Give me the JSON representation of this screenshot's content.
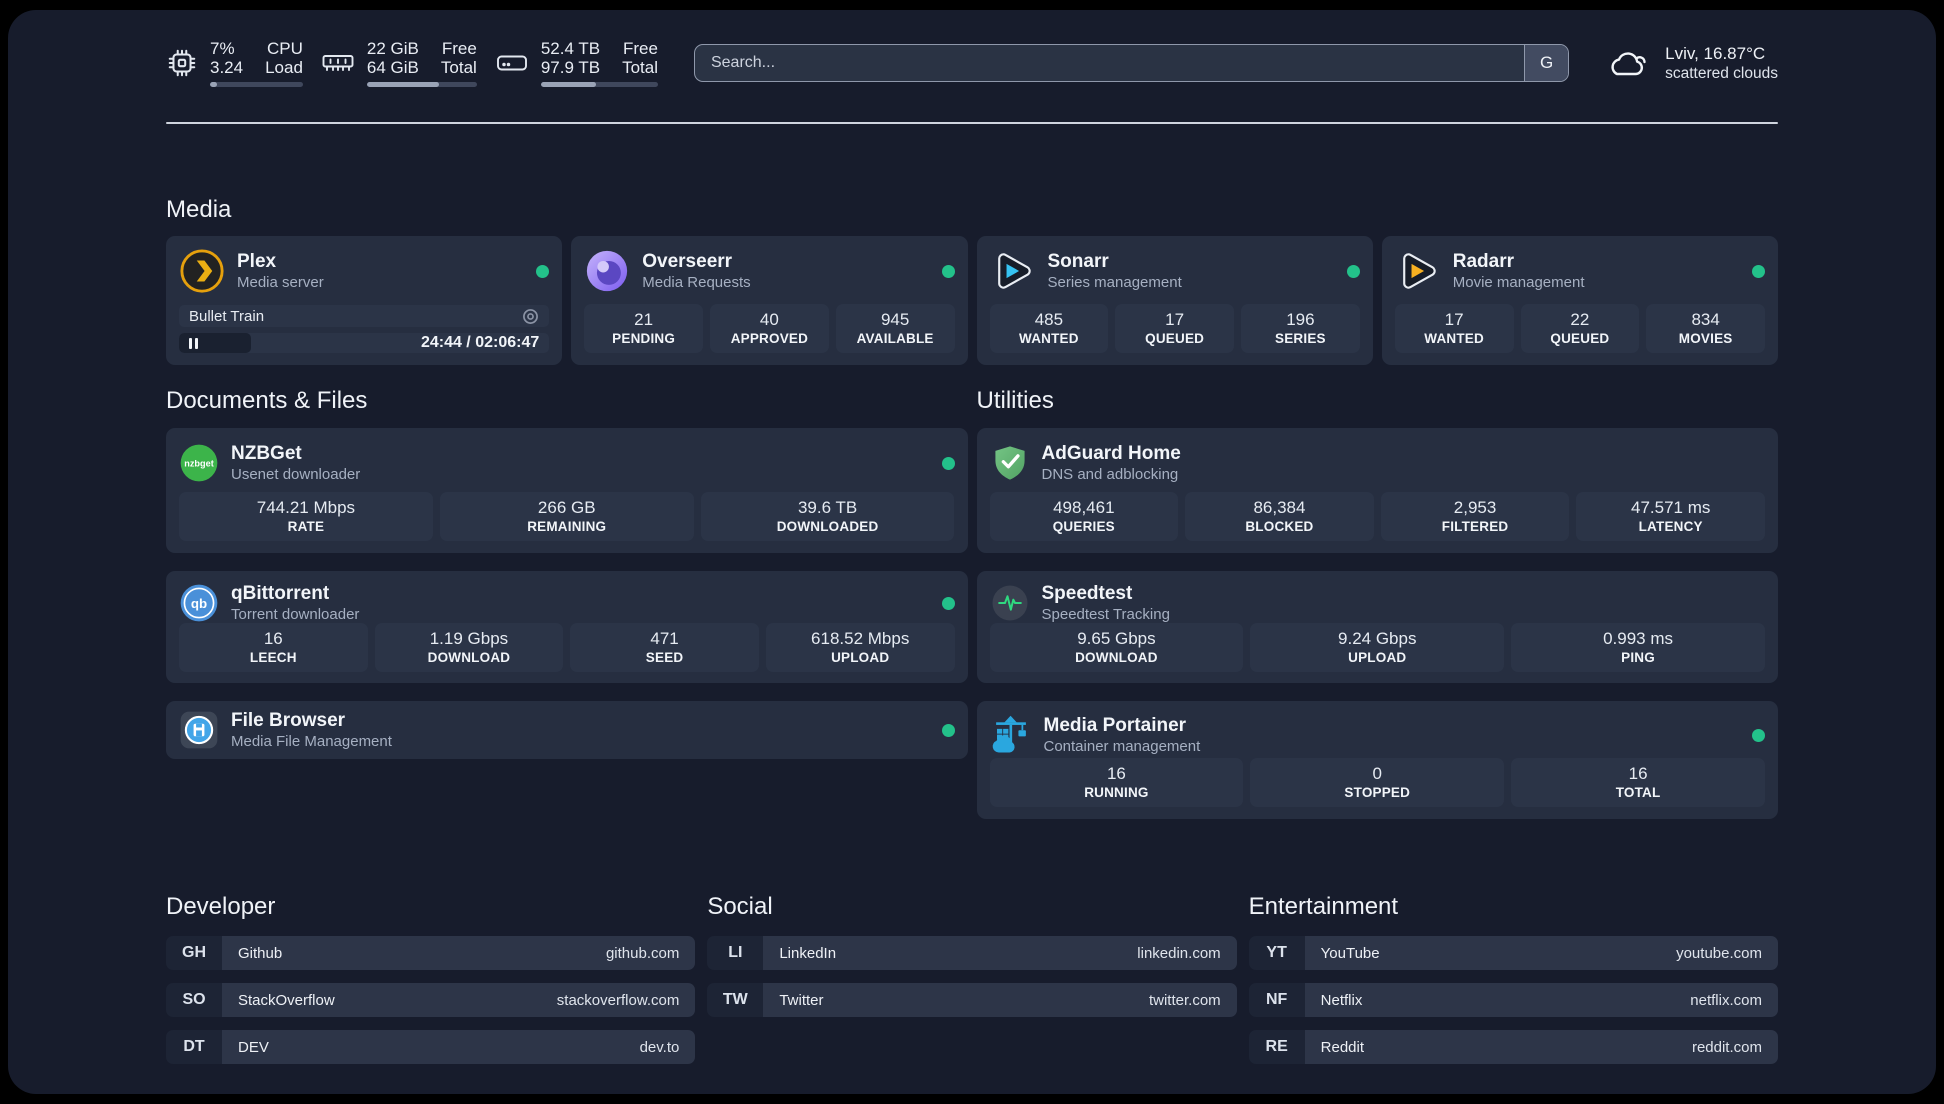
{
  "colors": {
    "background": "#171c2c",
    "card": "#262e40",
    "tile": "#2b3447",
    "accent_green": "#23c18a",
    "plex_orange": "#e5a00d",
    "sonarr_blue": "#36c3f1",
    "radarr_orange": "#f7b021",
    "divider": "#d9dee8"
  },
  "icons": {
    "header": [
      "cpu-icon",
      "memory-icon",
      "storage-icon",
      "cloud-icon"
    ],
    "apps": [
      "plex-icon",
      "overseerr-icon",
      "sonarr-icon",
      "radarr-icon",
      "nzbget-icon",
      "qbittorrent-icon",
      "filebrowser-icon",
      "adguard-icon",
      "speedtest-icon",
      "portainer-icon"
    ],
    "misc": [
      "disc-icon",
      "pause-icon",
      "status-dot"
    ]
  },
  "header": {
    "stats": [
      {
        "name": "cpu",
        "value1": "7%",
        "value2": "3.24",
        "label1": "CPU",
        "label2": "Load",
        "progress_pct": 8
      },
      {
        "name": "memory",
        "value1": "22 GiB",
        "value2": "64 GiB",
        "label1": "Free",
        "label2": "Total",
        "progress_pct": 66
      },
      {
        "name": "storage",
        "value1": "52.4 TB",
        "value2": "97.9 TB",
        "label1": "Free",
        "label2": "Total",
        "progress_pct": 47
      }
    ],
    "search": {
      "placeholder": "Search...",
      "button_label": "G"
    },
    "weather": {
      "location_temp": "Lviv, 16.87°C",
      "condition": "scattered clouds"
    }
  },
  "media": {
    "title": "Media",
    "plex": {
      "title": "Plex",
      "subtitle": "Media server",
      "online": true,
      "now_playing": {
        "title": "Bullet Train",
        "time_display": "24:44 / 02:06:47",
        "progress_pct": 19.5,
        "state": "paused"
      }
    },
    "cards": [
      {
        "title": "Overseerr",
        "subtitle": "Media Requests",
        "stats": [
          {
            "value": "21",
            "label": "PENDING"
          },
          {
            "value": "40",
            "label": "APPROVED"
          },
          {
            "value": "945",
            "label": "AVAILABLE"
          }
        ]
      },
      {
        "title": "Sonarr",
        "subtitle": "Series management",
        "stats": [
          {
            "value": "485",
            "label": "WANTED"
          },
          {
            "value": "17",
            "label": "QUEUED"
          },
          {
            "value": "196",
            "label": "SERIES"
          }
        ]
      },
      {
        "title": "Radarr",
        "subtitle": "Movie management",
        "stats": [
          {
            "value": "17",
            "label": "WANTED"
          },
          {
            "value": "22",
            "label": "QUEUED"
          },
          {
            "value": "834",
            "label": "MOVIES"
          }
        ]
      }
    ]
  },
  "documents": {
    "title": "Documents & Files",
    "cards": [
      {
        "title": "NZBGet",
        "subtitle": "Usenet downloader",
        "stats": [
          {
            "value": "744.21 Mbps",
            "label": "RATE"
          },
          {
            "value": "266 GB",
            "label": "REMAINING"
          },
          {
            "value": "39.6 TB",
            "label": "DOWNLOADED"
          }
        ]
      },
      {
        "title": "qBittorrent",
        "subtitle": "Torrent downloader",
        "stats": [
          {
            "value": "16",
            "label": "LEECH"
          },
          {
            "value": "1.19 Gbps",
            "label": "DOWNLOAD"
          },
          {
            "value": "471",
            "label": "SEED"
          },
          {
            "value": "618.52 Mbps",
            "label": "UPLOAD"
          }
        ]
      },
      {
        "title": "File Browser",
        "subtitle": "Media File Management",
        "stats": []
      }
    ]
  },
  "utilities": {
    "title": "Utilities",
    "cards": [
      {
        "title": "AdGuard Home",
        "subtitle": "DNS and adblocking",
        "stats": [
          {
            "value": "498,461",
            "label": "QUERIES"
          },
          {
            "value": "86,384",
            "label": "BLOCKED"
          },
          {
            "value": "2,953",
            "label": "FILTERED"
          },
          {
            "value": "47.571 ms",
            "label": "LATENCY"
          }
        ]
      },
      {
        "title": "Speedtest",
        "subtitle": "Speedtest Tracking",
        "stats": [
          {
            "value": "9.65 Gbps",
            "label": "DOWNLOAD"
          },
          {
            "value": "9.24 Gbps",
            "label": "UPLOAD"
          },
          {
            "value": "0.993 ms",
            "label": "PING"
          }
        ]
      },
      {
        "title": "Media Portainer",
        "subtitle": "Container management",
        "stats": [
          {
            "value": "16",
            "label": "RUNNING"
          },
          {
            "value": "0",
            "label": "STOPPED"
          },
          {
            "value": "16",
            "label": "TOTAL"
          }
        ]
      }
    ]
  },
  "links": {
    "developer": {
      "title": "Developer",
      "items": [
        {
          "badge": "GH",
          "name": "Github",
          "url": "github.com"
        },
        {
          "badge": "SO",
          "name": "StackOverflow",
          "url": "stackoverflow.com"
        },
        {
          "badge": "DT",
          "name": "DEV",
          "url": "dev.to"
        }
      ]
    },
    "social": {
      "title": "Social",
      "items": [
        {
          "badge": "LI",
          "name": "LinkedIn",
          "url": "linkedin.com"
        },
        {
          "badge": "TW",
          "name": "Twitter",
          "url": "twitter.com"
        }
      ]
    },
    "entertainment": {
      "title": "Entertainment",
      "items": [
        {
          "badge": "YT",
          "name": "YouTube",
          "url": "youtube.com"
        },
        {
          "badge": "NF",
          "name": "Netflix",
          "url": "netflix.com"
        },
        {
          "badge": "RE",
          "name": "Reddit",
          "url": "reddit.com"
        }
      ]
    }
  }
}
